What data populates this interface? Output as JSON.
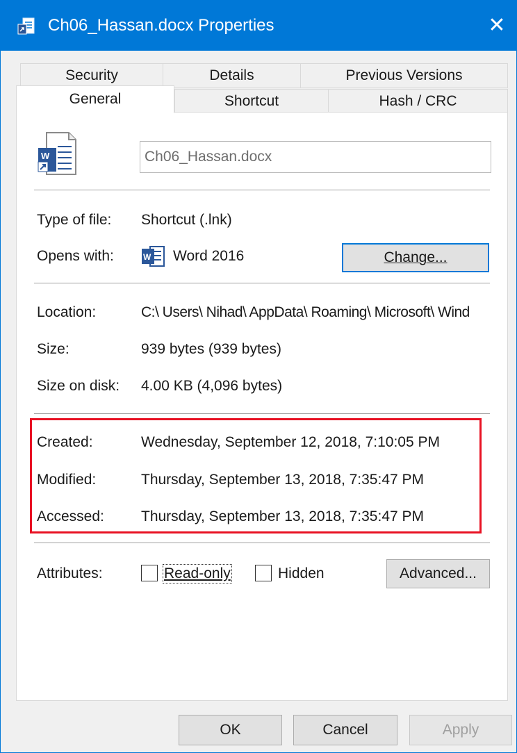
{
  "window": {
    "title": "Ch06_Hassan.docx Properties",
    "close_glyph": "✕"
  },
  "tabs": {
    "row1": [
      "Security",
      "Details",
      "Previous Versions"
    ],
    "row2": [
      "General",
      "Shortcut",
      "Hash / CRC"
    ],
    "active": "General"
  },
  "general": {
    "file_name": "Ch06_Hassan.docx",
    "type_label": "Type of file:",
    "type_value": "Shortcut (.lnk)",
    "opens_label": "Opens with:",
    "opens_value": "Word 2016",
    "change_button": "Change...",
    "location_label": "Location:",
    "location_value": "C:\\ Users\\ Nihad\\ AppData\\ Roaming\\ Microsoft\\ Wind",
    "size_label": "Size:",
    "size_value": "939 bytes (939 bytes)",
    "size_disk_label": "Size on disk:",
    "size_disk_value": "4.00 KB (4,096 bytes)",
    "created_label": "Created:",
    "created_value": "Wednesday, September 12, 2018, 7:10:05 PM",
    "modified_label": "Modified:",
    "modified_value": "Thursday, September 13, 2018, 7:35:47 PM",
    "accessed_label": "Accessed:",
    "accessed_value": "Thursday, September 13, 2018, 7:35:47 PM",
    "attributes_label": "Attributes:",
    "readonly_label": "Read-only",
    "hidden_label": "Hidden",
    "advanced_button": "Advanced..."
  },
  "footer": {
    "ok": "OK",
    "cancel": "Cancel",
    "apply": "Apply"
  },
  "colors": {
    "titlebar": "#0078d7",
    "highlight": "#e81123"
  }
}
